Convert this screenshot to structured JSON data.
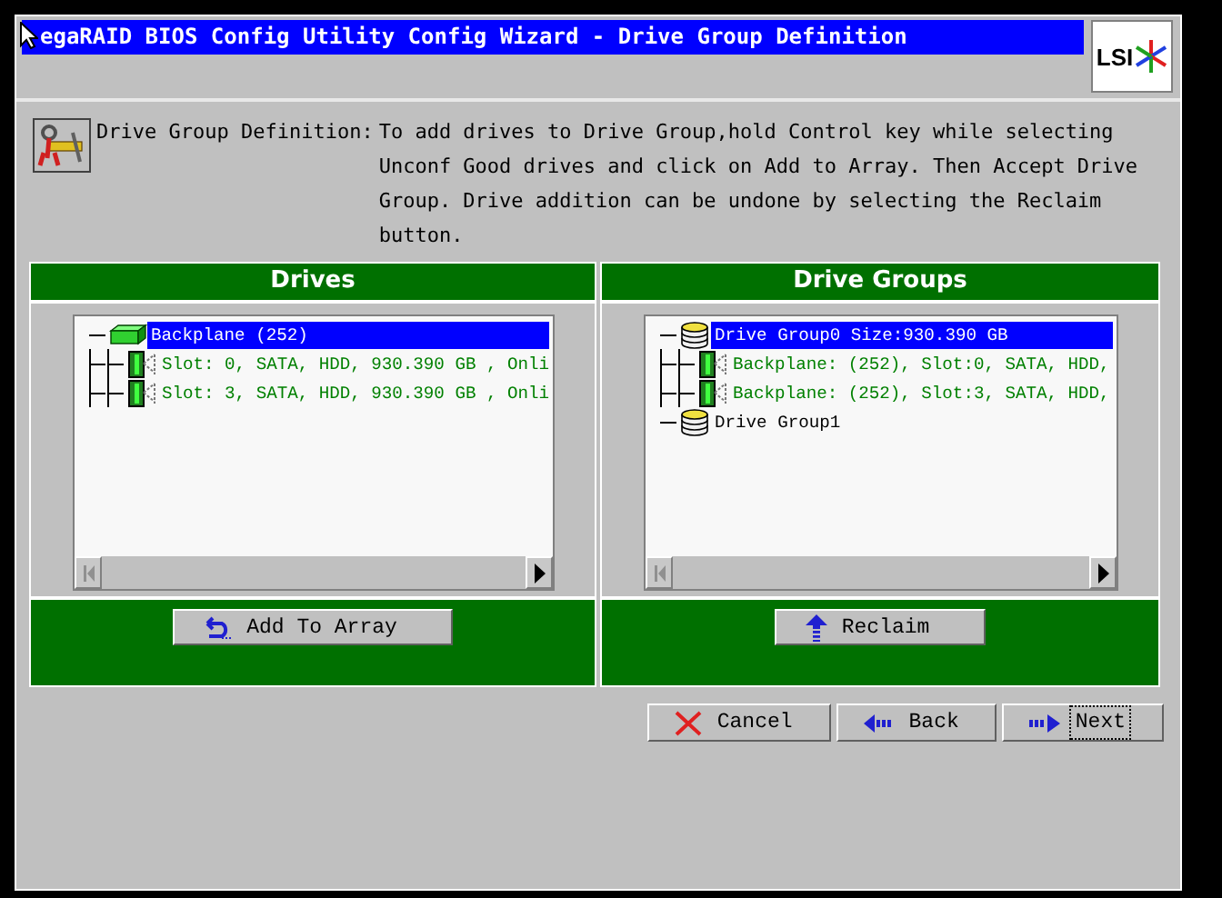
{
  "window": {
    "title": "egaRAID BIOS Config Utility  Config Wizard - Drive Group Definition",
    "logo": "LSI"
  },
  "description": {
    "label": "Drive Group Definition:",
    "text": "To add drives to Drive Group,hold Control key while selecting Unconf Good drives and click on Add to Array. Then Accept Drive Group. Drive addition can be undone by selecting the Reclaim button."
  },
  "panels": [
    {
      "title": "Drives",
      "items": [
        {
          "kind": "backplane",
          "label": "Backplane (252)",
          "selected": true,
          "children": [
            {
              "kind": "drive",
              "label": "Slot: 0, SATA, HDD, 930.390 GB , Onli",
              "selected": false
            },
            {
              "kind": "drive",
              "label": "Slot: 3, SATA, HDD, 930.390 GB , Onli",
              "selected": false
            }
          ]
        }
      ],
      "button": {
        "label": "Add To Array",
        "kind": "add"
      }
    },
    {
      "title": "Drive Groups",
      "items": [
        {
          "kind": "group",
          "label": "Drive Group0  Size:930.390 GB",
          "selected": true,
          "children": [
            {
              "kind": "drive",
              "label": "Backplane: (252), Slot:0, SATA, HDD,",
              "selected": false
            },
            {
              "kind": "drive",
              "label": "Backplane: (252), Slot:3, SATA, HDD,",
              "selected": false
            }
          ]
        },
        {
          "kind": "group",
          "label": "Drive Group1",
          "selected": false
        }
      ],
      "button": {
        "label": "Reclaim",
        "kind": "reclaim"
      }
    }
  ],
  "nav_buttons": [
    {
      "label": "Cancel",
      "kind": "cancel",
      "focused": false
    },
    {
      "label": "Back",
      "kind": "back",
      "focused": false
    },
    {
      "label": "Next",
      "kind": "next",
      "focused": true
    }
  ]
}
